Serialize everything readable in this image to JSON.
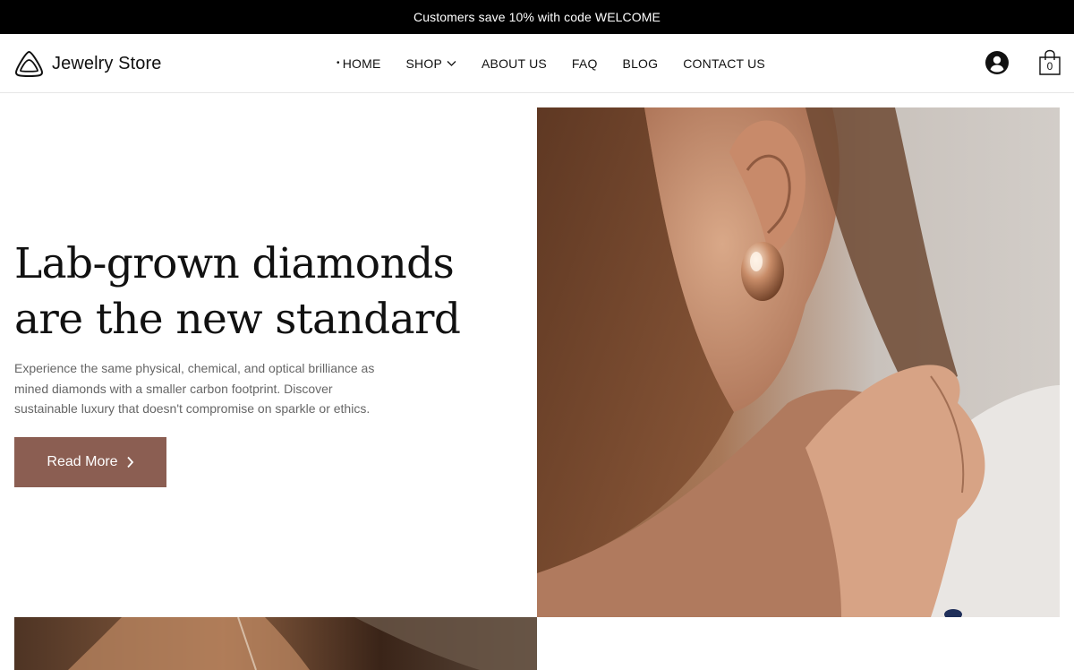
{
  "announcement": {
    "text": "Customers save 10% with code WELCOME"
  },
  "header": {
    "logo_text": "Jewelry Store",
    "nav": [
      {
        "label": "HOME",
        "active": true
      },
      {
        "label": "SHOP",
        "has_dropdown": true
      },
      {
        "label": "ABOUT US"
      },
      {
        "label": "FAQ"
      },
      {
        "label": "BLOG"
      },
      {
        "label": "CONTACT US"
      }
    ],
    "account_icon": "user-circle-icon",
    "cart_icon": "shopping-bag-icon",
    "cart_count": "0"
  },
  "hero": {
    "title_line1": "Lab-grown diamonds",
    "title_line2": "are the new standard",
    "description": "Experience the same physical, chemical, and optical brilliance as mined diamonds with a smaller carbon footprint. Discover sustainable luxury that doesn't compromise on sparkle or ethics.",
    "button_label": "Read More",
    "button_color": "#8b5e52"
  },
  "colors": {
    "announcement_bg": "#000000",
    "accent": "#8b5e52",
    "text": "#111111",
    "muted_text": "#666666"
  }
}
